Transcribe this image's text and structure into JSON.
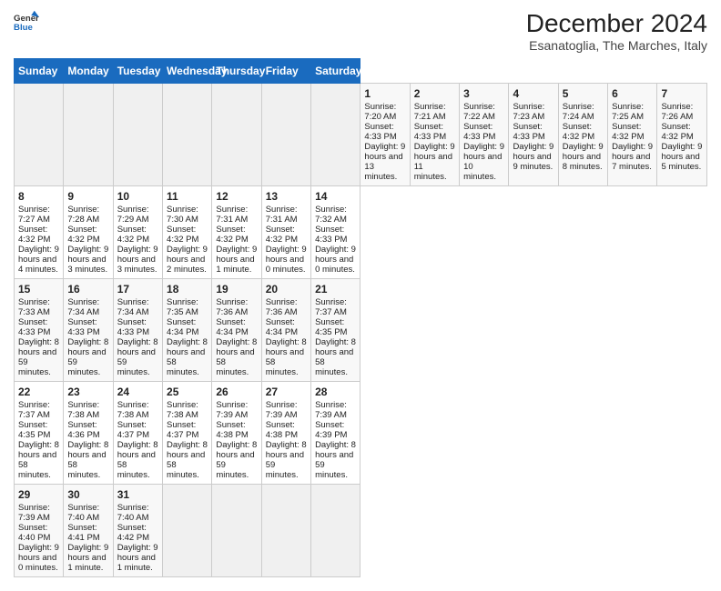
{
  "header": {
    "logo_line1": "General",
    "logo_line2": "Blue",
    "title": "December 2024",
    "subtitle": "Esanatoglia, The Marches, Italy"
  },
  "calendar": {
    "days_of_week": [
      "Sunday",
      "Monday",
      "Tuesday",
      "Wednesday",
      "Thursday",
      "Friday",
      "Saturday"
    ],
    "weeks": [
      [
        {
          "day": "",
          "empty": true
        },
        {
          "day": "",
          "empty": true
        },
        {
          "day": "",
          "empty": true
        },
        {
          "day": "",
          "empty": true
        },
        {
          "day": "",
          "empty": true
        },
        {
          "day": "",
          "empty": true
        },
        {
          "day": "",
          "empty": true
        },
        {
          "day": "1",
          "sunrise": "Sunrise: 7:20 AM",
          "sunset": "Sunset: 4:33 PM",
          "daylight": "Daylight: 9 hours and 13 minutes."
        },
        {
          "day": "2",
          "sunrise": "Sunrise: 7:21 AM",
          "sunset": "Sunset: 4:33 PM",
          "daylight": "Daylight: 9 hours and 11 minutes."
        },
        {
          "day": "3",
          "sunrise": "Sunrise: 7:22 AM",
          "sunset": "Sunset: 4:33 PM",
          "daylight": "Daylight: 9 hours and 10 minutes."
        },
        {
          "day": "4",
          "sunrise": "Sunrise: 7:23 AM",
          "sunset": "Sunset: 4:33 PM",
          "daylight": "Daylight: 9 hours and 9 minutes."
        },
        {
          "day": "5",
          "sunrise": "Sunrise: 7:24 AM",
          "sunset": "Sunset: 4:32 PM",
          "daylight": "Daylight: 9 hours and 8 minutes."
        },
        {
          "day": "6",
          "sunrise": "Sunrise: 7:25 AM",
          "sunset": "Sunset: 4:32 PM",
          "daylight": "Daylight: 9 hours and 7 minutes."
        },
        {
          "day": "7",
          "sunrise": "Sunrise: 7:26 AM",
          "sunset": "Sunset: 4:32 PM",
          "daylight": "Daylight: 9 hours and 5 minutes."
        }
      ],
      [
        {
          "day": "8",
          "sunrise": "Sunrise: 7:27 AM",
          "sunset": "Sunset: 4:32 PM",
          "daylight": "Daylight: 9 hours and 4 minutes."
        },
        {
          "day": "9",
          "sunrise": "Sunrise: 7:28 AM",
          "sunset": "Sunset: 4:32 PM",
          "daylight": "Daylight: 9 hours and 3 minutes."
        },
        {
          "day": "10",
          "sunrise": "Sunrise: 7:29 AM",
          "sunset": "Sunset: 4:32 PM",
          "daylight": "Daylight: 9 hours and 3 minutes."
        },
        {
          "day": "11",
          "sunrise": "Sunrise: 7:30 AM",
          "sunset": "Sunset: 4:32 PM",
          "daylight": "Daylight: 9 hours and 2 minutes."
        },
        {
          "day": "12",
          "sunrise": "Sunrise: 7:31 AM",
          "sunset": "Sunset: 4:32 PM",
          "daylight": "Daylight: 9 hours and 1 minute."
        },
        {
          "day": "13",
          "sunrise": "Sunrise: 7:31 AM",
          "sunset": "Sunset: 4:32 PM",
          "daylight": "Daylight: 9 hours and 0 minutes."
        },
        {
          "day": "14",
          "sunrise": "Sunrise: 7:32 AM",
          "sunset": "Sunset: 4:33 PM",
          "daylight": "Daylight: 9 hours and 0 minutes."
        }
      ],
      [
        {
          "day": "15",
          "sunrise": "Sunrise: 7:33 AM",
          "sunset": "Sunset: 4:33 PM",
          "daylight": "Daylight: 8 hours and 59 minutes."
        },
        {
          "day": "16",
          "sunrise": "Sunrise: 7:34 AM",
          "sunset": "Sunset: 4:33 PM",
          "daylight": "Daylight: 8 hours and 59 minutes."
        },
        {
          "day": "17",
          "sunrise": "Sunrise: 7:34 AM",
          "sunset": "Sunset: 4:33 PM",
          "daylight": "Daylight: 8 hours and 59 minutes."
        },
        {
          "day": "18",
          "sunrise": "Sunrise: 7:35 AM",
          "sunset": "Sunset: 4:34 PM",
          "daylight": "Daylight: 8 hours and 58 minutes."
        },
        {
          "day": "19",
          "sunrise": "Sunrise: 7:36 AM",
          "sunset": "Sunset: 4:34 PM",
          "daylight": "Daylight: 8 hours and 58 minutes."
        },
        {
          "day": "20",
          "sunrise": "Sunrise: 7:36 AM",
          "sunset": "Sunset: 4:34 PM",
          "daylight": "Daylight: 8 hours and 58 minutes."
        },
        {
          "day": "21",
          "sunrise": "Sunrise: 7:37 AM",
          "sunset": "Sunset: 4:35 PM",
          "daylight": "Daylight: 8 hours and 58 minutes."
        }
      ],
      [
        {
          "day": "22",
          "sunrise": "Sunrise: 7:37 AM",
          "sunset": "Sunset: 4:35 PM",
          "daylight": "Daylight: 8 hours and 58 minutes."
        },
        {
          "day": "23",
          "sunrise": "Sunrise: 7:38 AM",
          "sunset": "Sunset: 4:36 PM",
          "daylight": "Daylight: 8 hours and 58 minutes."
        },
        {
          "day": "24",
          "sunrise": "Sunrise: 7:38 AM",
          "sunset": "Sunset: 4:37 PM",
          "daylight": "Daylight: 8 hours and 58 minutes."
        },
        {
          "day": "25",
          "sunrise": "Sunrise: 7:38 AM",
          "sunset": "Sunset: 4:37 PM",
          "daylight": "Daylight: 8 hours and 58 minutes."
        },
        {
          "day": "26",
          "sunrise": "Sunrise: 7:39 AM",
          "sunset": "Sunset: 4:38 PM",
          "daylight": "Daylight: 8 hours and 59 minutes."
        },
        {
          "day": "27",
          "sunrise": "Sunrise: 7:39 AM",
          "sunset": "Sunset: 4:38 PM",
          "daylight": "Daylight: 8 hours and 59 minutes."
        },
        {
          "day": "28",
          "sunrise": "Sunrise: 7:39 AM",
          "sunset": "Sunset: 4:39 PM",
          "daylight": "Daylight: 8 hours and 59 minutes."
        }
      ],
      [
        {
          "day": "29",
          "sunrise": "Sunrise: 7:39 AM",
          "sunset": "Sunset: 4:40 PM",
          "daylight": "Daylight: 9 hours and 0 minutes."
        },
        {
          "day": "30",
          "sunrise": "Sunrise: 7:40 AM",
          "sunset": "Sunset: 4:41 PM",
          "daylight": "Daylight: 9 hours and 1 minute."
        },
        {
          "day": "31",
          "sunrise": "Sunrise: 7:40 AM",
          "sunset": "Sunset: 4:42 PM",
          "daylight": "Daylight: 9 hours and 1 minute."
        },
        {
          "day": "",
          "empty": true
        },
        {
          "day": "",
          "empty": true
        },
        {
          "day": "",
          "empty": true
        },
        {
          "day": "",
          "empty": true
        }
      ]
    ]
  }
}
